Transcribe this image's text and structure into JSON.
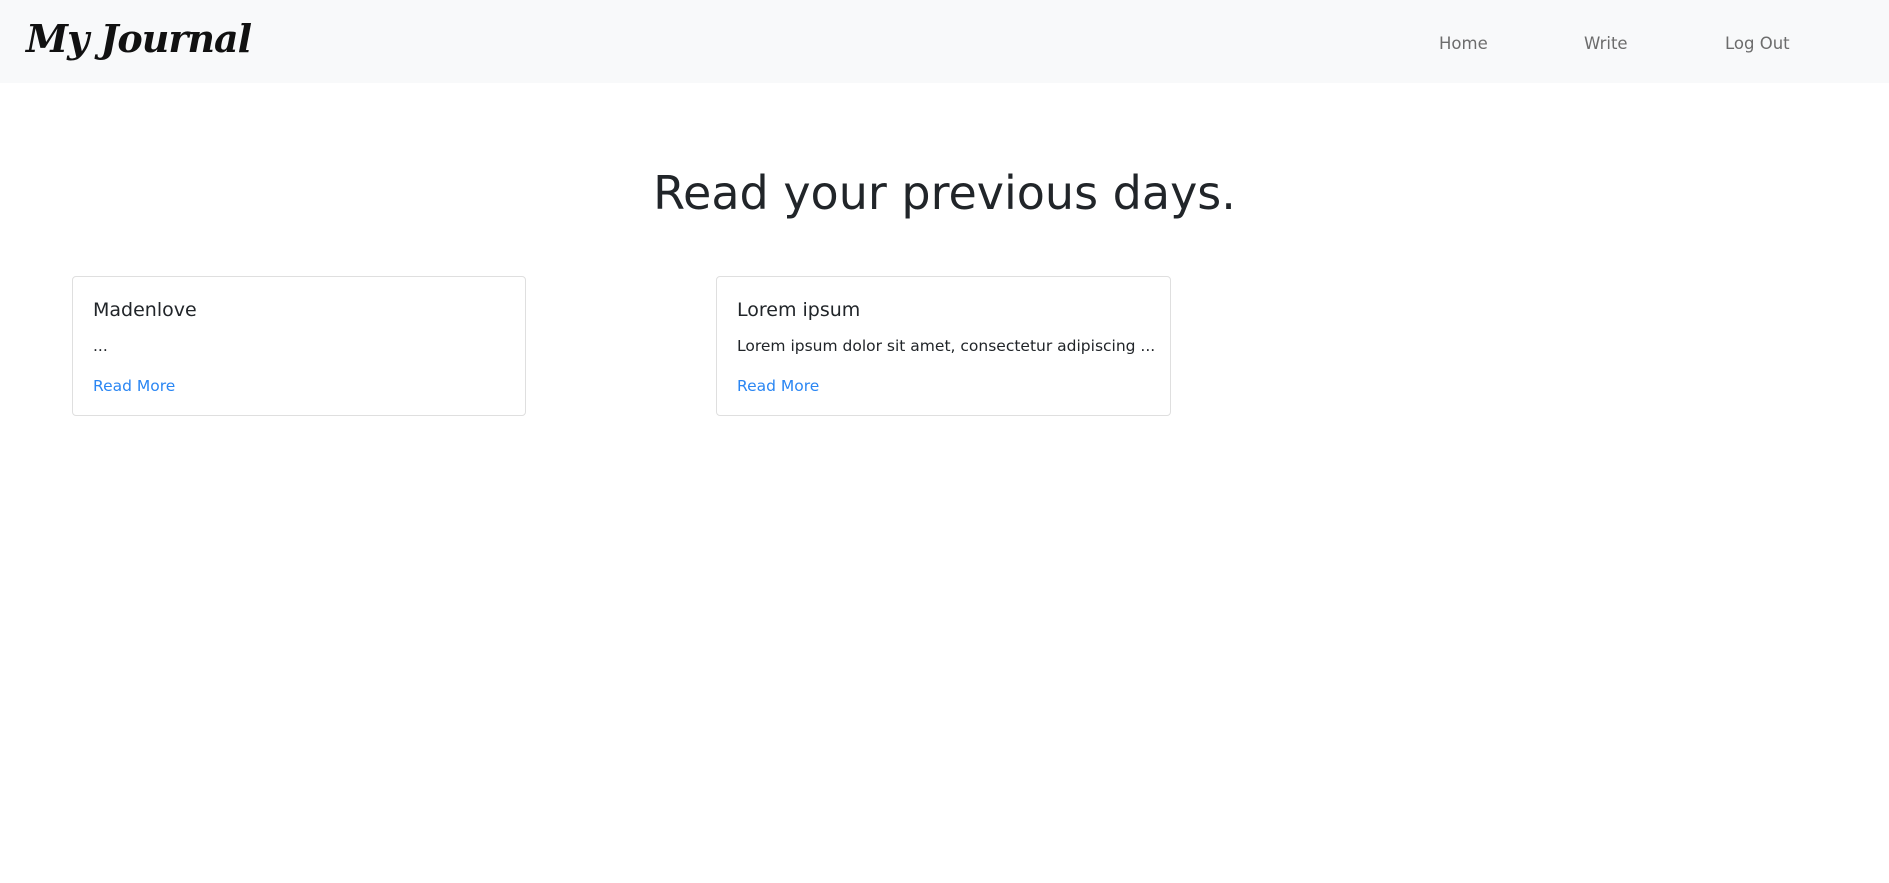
{
  "navbar": {
    "brand": "My Journal",
    "links": [
      {
        "label": "Home"
      },
      {
        "label": "Write"
      },
      {
        "label": "Log Out"
      }
    ]
  },
  "main": {
    "title": "Read your previous days.",
    "entries": [
      {
        "title": "Madenlove",
        "excerpt": "...",
        "link_label": "Read More"
      },
      {
        "title": "Lorem ipsum",
        "excerpt": "Lorem ipsum dolor sit amet, consectetur adipiscing ...",
        "link_label": "Read More"
      }
    ]
  },
  "colors": {
    "navbar_bg": "#f8f9fa",
    "link_accent": "#2a86f3",
    "nav_text": "#6c6c6c",
    "card_border": "#dfdfdf"
  }
}
